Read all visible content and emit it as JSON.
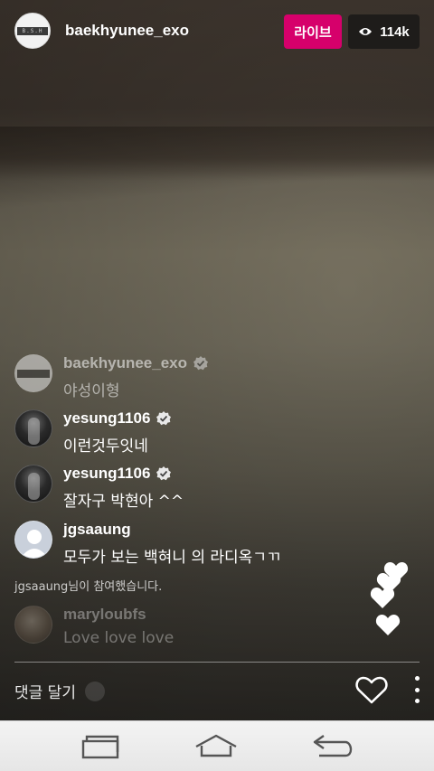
{
  "header": {
    "host_username": "baekhyunee_exo",
    "host_avatar_text": "B.S.H",
    "live_label": "라이브",
    "viewer_count": "114k",
    "viewer_icon": "eye-icon"
  },
  "comments": [
    {
      "username": "baekhyunee_exo",
      "verified": true,
      "text": "야성이형",
      "avatar": "bsh-strip"
    },
    {
      "username": "yesung1106",
      "verified": true,
      "text": "이런것두잇네",
      "avatar": "dark-photo"
    },
    {
      "username": "yesung1106",
      "verified": true,
      "text": "잘자구 박현아 ^^",
      "avatar": "dark-photo"
    },
    {
      "username": "jgsaaung",
      "verified": false,
      "text": "모두가 보는 백혀니 의 라디옥ㄱㄲ",
      "avatar": "default-user"
    },
    {
      "username": "maryloubfs",
      "verified": false,
      "text": "Love love love",
      "avatar": "photo"
    }
  ],
  "system_message": "jgsaaung님이 참여했습니다.",
  "input": {
    "placeholder": "댓글 달기"
  },
  "colors": {
    "live_badge": "#d6006b",
    "nav_bar": "#eeeeee"
  },
  "icons": [
    "heart-icon",
    "more-icon",
    "recent-apps-icon",
    "home-icon",
    "back-icon"
  ]
}
